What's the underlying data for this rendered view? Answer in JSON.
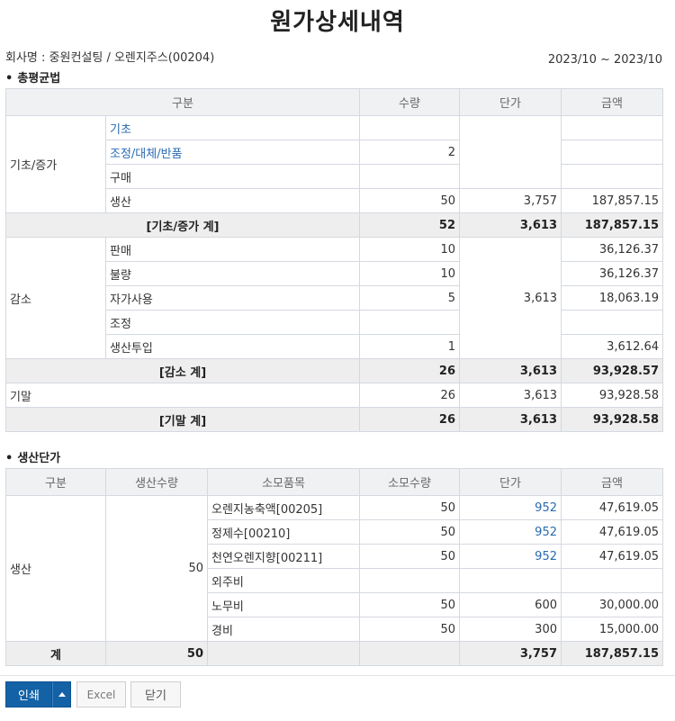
{
  "title": "원가상세내역",
  "company_line": "회사명 : 중원컨설팅 / 오렌지주스(00204)",
  "period": "2023/10 ~ 2023/10",
  "section1": {
    "bullet": "•",
    "title": "총평균법",
    "headers": {
      "category": "구분",
      "qty": "수량",
      "unit": "단가",
      "amount": "금액"
    },
    "group1": {
      "label": "기초/증가",
      "rows": [
        {
          "label": "기초",
          "qty": "",
          "amount": ""
        },
        {
          "label": "조정/대체/반품",
          "qty": "2",
          "amount": ""
        },
        {
          "label": "구매",
          "qty": "",
          "amount": ""
        },
        {
          "label": "생산",
          "qty": "50",
          "unit": "3,757",
          "amount": "187,857.15"
        }
      ],
      "subtotal": {
        "label": "[기초/증가 계]",
        "qty": "52",
        "unit": "3,613",
        "amount": "187,857.15"
      }
    },
    "group2": {
      "label": "감소",
      "unit": "3,613",
      "rows": [
        {
          "label": "판매",
          "qty": "10",
          "amount": "36,126.37"
        },
        {
          "label": "불량",
          "qty": "10",
          "amount": "36,126.37"
        },
        {
          "label": "자가사용",
          "qty": "5",
          "amount": "18,063.19"
        },
        {
          "label": "조정",
          "qty": "",
          "amount": ""
        },
        {
          "label": "생산투입",
          "qty": "1",
          "amount": "3,612.64"
        }
      ],
      "subtotal": {
        "label": "[감소 계]",
        "qty": "26",
        "unit": "3,613",
        "amount": "93,928.57"
      }
    },
    "ending": {
      "label": "기말",
      "qty": "26",
      "unit": "3,613",
      "amount": "93,928.58"
    },
    "ending_total": {
      "label": "[기말 계]",
      "qty": "26",
      "unit": "3,613",
      "amount": "93,928.58"
    }
  },
  "section2": {
    "bullet": "•",
    "title": "생산단가",
    "headers": {
      "category": "구분",
      "prod_qty": "생산수량",
      "item": "소모품목",
      "use_qty": "소모수량",
      "unit": "단가",
      "amount": "금액"
    },
    "group": {
      "label": "생산",
      "prod_qty": "50"
    },
    "rows": [
      {
        "item": "오렌지농축액[00205]",
        "use_qty": "50",
        "unit": "952",
        "amount": "47,619.05"
      },
      {
        "item": "정제수[00210]",
        "use_qty": "50",
        "unit": "952",
        "amount": "47,619.05"
      },
      {
        "item": "천연오렌지향[00211]",
        "use_qty": "50",
        "unit": "952",
        "amount": "47,619.05"
      },
      {
        "item": "외주비",
        "use_qty": "",
        "unit": "",
        "amount": ""
      },
      {
        "item": "노무비",
        "use_qty": "50",
        "unit": "600",
        "amount": "30,000.00"
      },
      {
        "item": "경비",
        "use_qty": "50",
        "unit": "300",
        "amount": "15,000.00"
      }
    ],
    "total": {
      "label": "계",
      "prod_qty": "50",
      "unit": "3,757",
      "amount": "187,857.15"
    }
  },
  "buttons": {
    "print": "인쇄",
    "excel": "Excel",
    "close": "닫기"
  },
  "colors": {
    "primary_button": "#1462a6",
    "link_text": "#2a6ab0",
    "header_bg": "#f0f1f3",
    "subtotal_bg": "#eeeeee"
  },
  "icons": {
    "print_dropdown": "caret-up-icon"
  }
}
